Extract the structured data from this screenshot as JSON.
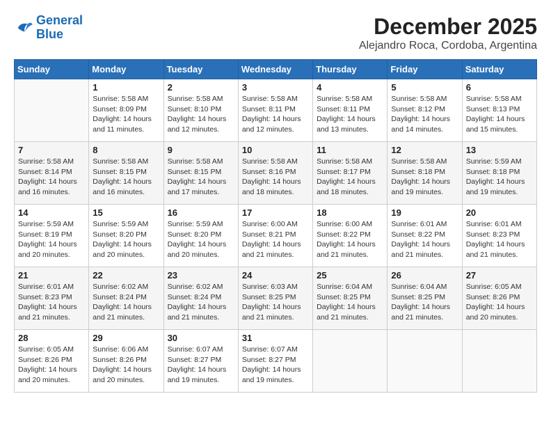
{
  "logo": {
    "line1": "General",
    "line2": "Blue"
  },
  "title": "December 2025",
  "subtitle": "Alejandro Roca, Cordoba, Argentina",
  "days_of_week": [
    "Sunday",
    "Monday",
    "Tuesday",
    "Wednesday",
    "Thursday",
    "Friday",
    "Saturday"
  ],
  "weeks": [
    [
      {
        "day": "",
        "info": ""
      },
      {
        "day": "1",
        "info": "Sunrise: 5:58 AM\nSunset: 8:09 PM\nDaylight: 14 hours\nand 11 minutes."
      },
      {
        "day": "2",
        "info": "Sunrise: 5:58 AM\nSunset: 8:10 PM\nDaylight: 14 hours\nand 12 minutes."
      },
      {
        "day": "3",
        "info": "Sunrise: 5:58 AM\nSunset: 8:11 PM\nDaylight: 14 hours\nand 12 minutes."
      },
      {
        "day": "4",
        "info": "Sunrise: 5:58 AM\nSunset: 8:11 PM\nDaylight: 14 hours\nand 13 minutes."
      },
      {
        "day": "5",
        "info": "Sunrise: 5:58 AM\nSunset: 8:12 PM\nDaylight: 14 hours\nand 14 minutes."
      },
      {
        "day": "6",
        "info": "Sunrise: 5:58 AM\nSunset: 8:13 PM\nDaylight: 14 hours\nand 15 minutes."
      }
    ],
    [
      {
        "day": "7",
        "info": "Sunrise: 5:58 AM\nSunset: 8:14 PM\nDaylight: 14 hours\nand 16 minutes."
      },
      {
        "day": "8",
        "info": "Sunrise: 5:58 AM\nSunset: 8:15 PM\nDaylight: 14 hours\nand 16 minutes."
      },
      {
        "day": "9",
        "info": "Sunrise: 5:58 AM\nSunset: 8:15 PM\nDaylight: 14 hours\nand 17 minutes."
      },
      {
        "day": "10",
        "info": "Sunrise: 5:58 AM\nSunset: 8:16 PM\nDaylight: 14 hours\nand 18 minutes."
      },
      {
        "day": "11",
        "info": "Sunrise: 5:58 AM\nSunset: 8:17 PM\nDaylight: 14 hours\nand 18 minutes."
      },
      {
        "day": "12",
        "info": "Sunrise: 5:58 AM\nSunset: 8:18 PM\nDaylight: 14 hours\nand 19 minutes."
      },
      {
        "day": "13",
        "info": "Sunrise: 5:59 AM\nSunset: 8:18 PM\nDaylight: 14 hours\nand 19 minutes."
      }
    ],
    [
      {
        "day": "14",
        "info": "Sunrise: 5:59 AM\nSunset: 8:19 PM\nDaylight: 14 hours\nand 20 minutes."
      },
      {
        "day": "15",
        "info": "Sunrise: 5:59 AM\nSunset: 8:20 PM\nDaylight: 14 hours\nand 20 minutes."
      },
      {
        "day": "16",
        "info": "Sunrise: 5:59 AM\nSunset: 8:20 PM\nDaylight: 14 hours\nand 20 minutes."
      },
      {
        "day": "17",
        "info": "Sunrise: 6:00 AM\nSunset: 8:21 PM\nDaylight: 14 hours\nand 21 minutes."
      },
      {
        "day": "18",
        "info": "Sunrise: 6:00 AM\nSunset: 8:22 PM\nDaylight: 14 hours\nand 21 minutes."
      },
      {
        "day": "19",
        "info": "Sunrise: 6:01 AM\nSunset: 8:22 PM\nDaylight: 14 hours\nand 21 minutes."
      },
      {
        "day": "20",
        "info": "Sunrise: 6:01 AM\nSunset: 8:23 PM\nDaylight: 14 hours\nand 21 minutes."
      }
    ],
    [
      {
        "day": "21",
        "info": "Sunrise: 6:01 AM\nSunset: 8:23 PM\nDaylight: 14 hours\nand 21 minutes."
      },
      {
        "day": "22",
        "info": "Sunrise: 6:02 AM\nSunset: 8:24 PM\nDaylight: 14 hours\nand 21 minutes."
      },
      {
        "day": "23",
        "info": "Sunrise: 6:02 AM\nSunset: 8:24 PM\nDaylight: 14 hours\nand 21 minutes."
      },
      {
        "day": "24",
        "info": "Sunrise: 6:03 AM\nSunset: 8:25 PM\nDaylight: 14 hours\nand 21 minutes."
      },
      {
        "day": "25",
        "info": "Sunrise: 6:04 AM\nSunset: 8:25 PM\nDaylight: 14 hours\nand 21 minutes."
      },
      {
        "day": "26",
        "info": "Sunrise: 6:04 AM\nSunset: 8:25 PM\nDaylight: 14 hours\nand 21 minutes."
      },
      {
        "day": "27",
        "info": "Sunrise: 6:05 AM\nSunset: 8:26 PM\nDaylight: 14 hours\nand 20 minutes."
      }
    ],
    [
      {
        "day": "28",
        "info": "Sunrise: 6:05 AM\nSunset: 8:26 PM\nDaylight: 14 hours\nand 20 minutes."
      },
      {
        "day": "29",
        "info": "Sunrise: 6:06 AM\nSunset: 8:26 PM\nDaylight: 14 hours\nand 20 minutes."
      },
      {
        "day": "30",
        "info": "Sunrise: 6:07 AM\nSunset: 8:27 PM\nDaylight: 14 hours\nand 19 minutes."
      },
      {
        "day": "31",
        "info": "Sunrise: 6:07 AM\nSunset: 8:27 PM\nDaylight: 14 hours\nand 19 minutes."
      },
      {
        "day": "",
        "info": ""
      },
      {
        "day": "",
        "info": ""
      },
      {
        "day": "",
        "info": ""
      }
    ]
  ]
}
